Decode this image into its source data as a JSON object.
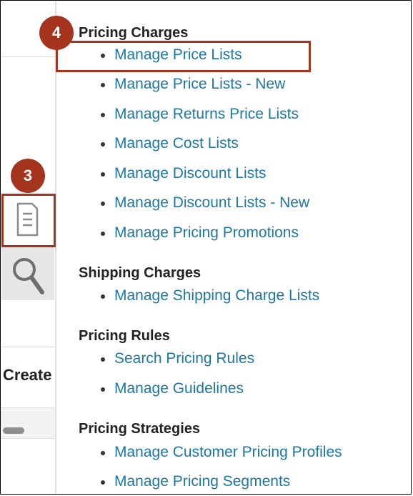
{
  "callouts": {
    "step3": "3",
    "step4": "4"
  },
  "left_panel": {
    "created_label": "Create"
  },
  "sections": [
    {
      "heading": "Pricing Charges",
      "items": [
        "Manage Price Lists",
        "Manage Price Lists - New",
        "Manage Returns Price Lists",
        "Manage Cost Lists",
        "Manage Discount Lists",
        "Manage Discount Lists - New",
        "Manage Pricing Promotions"
      ]
    },
    {
      "heading": "Shipping Charges",
      "items": [
        "Manage Shipping Charge Lists"
      ]
    },
    {
      "heading": "Pricing Rules",
      "items": [
        "Search Pricing Rules",
        "Manage Guidelines"
      ]
    },
    {
      "heading": "Pricing Strategies",
      "items": [
        "Manage Customer Pricing Profiles",
        "Manage Pricing Segments"
      ]
    }
  ],
  "colors": {
    "accent": "#a5341f",
    "link": "#1d77a6"
  }
}
